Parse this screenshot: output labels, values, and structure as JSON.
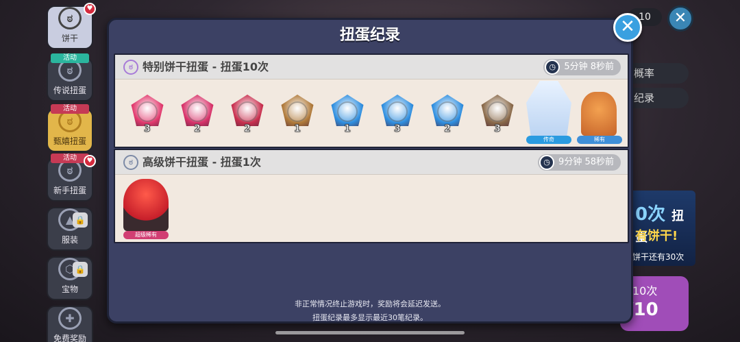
{
  "sidebar": {
    "items": [
      {
        "label": "饼干",
        "tag": "",
        "heart": true
      },
      {
        "label": "传说扭蛋",
        "tag": "活动",
        "heart": false
      },
      {
        "label": "甄嬉扭蛋",
        "tag": "活动",
        "heart": false
      },
      {
        "label": "新手扭蛋",
        "tag": "活动",
        "heart": true
      },
      {
        "label": "服装",
        "tag": "",
        "heart": false
      },
      {
        "label": "宝物",
        "tag": "",
        "heart": false
      },
      {
        "label": "免费奖励",
        "tag": "",
        "heart": false
      }
    ]
  },
  "background": {
    "top_count": "10",
    "probability_btn": "概率",
    "record_btn": "纪录",
    "banner_count": "0次",
    "banner_word": "扭蛋",
    "banner_line2": "有饼干!",
    "banner_line3": "饼干还有30次",
    "purple_line1": "10次",
    "purple_line2": "/10"
  },
  "modal": {
    "title": "扭蛋纪录",
    "records": [
      {
        "title": "特别饼干扭蛋 - 扭蛋10次",
        "time": "5分钟 8秒前",
        "items": [
          {
            "kind": "soulstone",
            "color": "#e23a6e",
            "count": "3"
          },
          {
            "kind": "soulstone",
            "color": "#d8336a",
            "count": "2"
          },
          {
            "kind": "soulstone",
            "color": "#c9304f",
            "count": "2"
          },
          {
            "kind": "soulstone",
            "color": "#b07a3a",
            "count": "1"
          },
          {
            "kind": "soulstone",
            "color": "#2f8fe0",
            "count": "1"
          },
          {
            "kind": "soulstone",
            "color": "#2f8fe0",
            "count": "3"
          },
          {
            "kind": "soulstone",
            "color": "#2f8fe0",
            "count": "2"
          },
          {
            "kind": "soulstone",
            "color": "#8a6a4a",
            "count": "3"
          }
        ],
        "cookies": [
          {
            "rarity": "传奇",
            "rarity_color": "#2a9be0"
          },
          {
            "rarity": "稀有",
            "rarity_color": "#3f8fd8"
          }
        ]
      },
      {
        "title": "高级饼干扭蛋 - 扭蛋1次",
        "time": "9分钟 58秒前",
        "cookies": [
          {
            "rarity": "超级稀有",
            "rarity_color": "#d13e73"
          }
        ]
      }
    ],
    "footer_line1": "非正常情况终止游戏时，奖励将会延迟发送。",
    "footer_line2": "扭蛋纪录最多显示最近30笔纪录。"
  }
}
